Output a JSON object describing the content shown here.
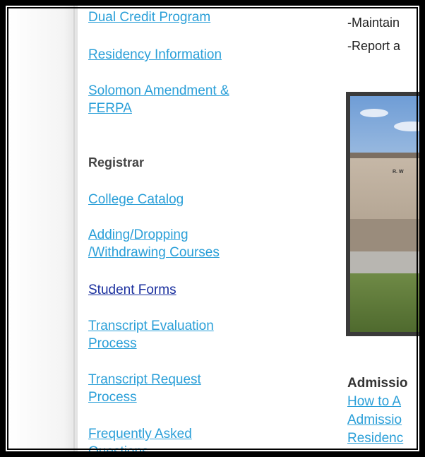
{
  "sidebar": {
    "links_top": [
      {
        "label": "Dual Credit Program"
      },
      {
        "label": "Residency Information"
      },
      {
        "label": "Solomon Amendment & FERPA"
      }
    ],
    "section_heading": "Registrar",
    "links": [
      {
        "label": "College Catalog"
      },
      {
        "label": "Adding/Dropping /Withdrawing Courses"
      },
      {
        "label": "Student Forms"
      },
      {
        "label": "Transcript Evaluation Process"
      },
      {
        "label": "Transcript Request Process"
      },
      {
        "label": "Frequently Asked Questions"
      }
    ]
  },
  "main": {
    "bullets": [
      "-Maintain",
      "-Report a"
    ],
    "photo_sign": "R. W",
    "admissions_heading": "Admissio",
    "admissions_links": [
      "How to A",
      "Admissio",
      "Residenc"
    ]
  },
  "colors": {
    "link": "#2a9fd8",
    "visited_link": "#1a2f9e",
    "heading": "#444444"
  }
}
